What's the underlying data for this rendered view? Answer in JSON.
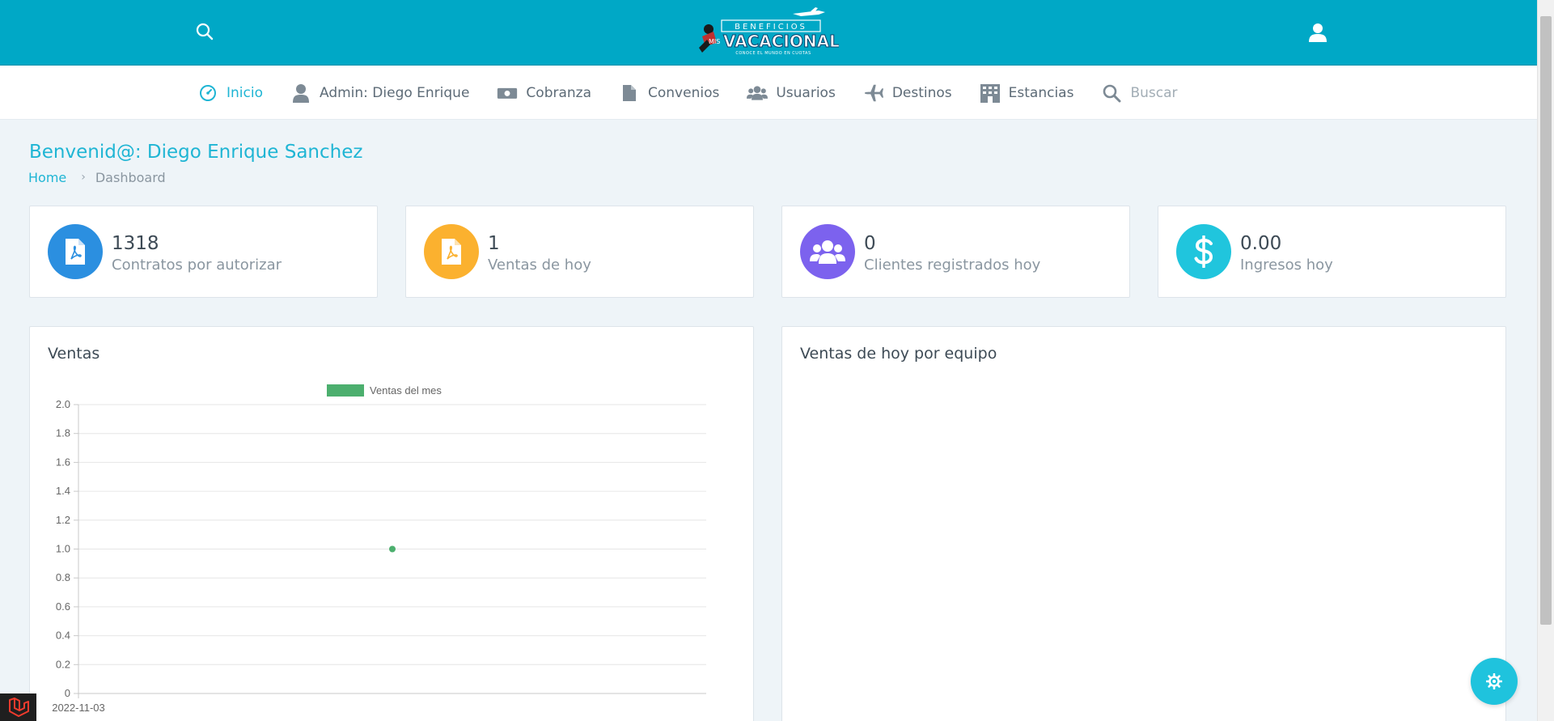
{
  "logo": {
    "line1": "BENEFICIOS",
    "line2_small": "MIS",
    "line2": "VACACIONALES",
    "line3": "CONOCE EL MUNDO EN CUOTAS"
  },
  "nav": {
    "items": [
      {
        "label": "Inicio",
        "icon": "dashboard-icon"
      },
      {
        "label": "Admin: Diego Enrique",
        "icon": "user-icon"
      },
      {
        "label": "Cobranza",
        "icon": "money-icon"
      },
      {
        "label": "Convenios",
        "icon": "file-icon"
      },
      {
        "label": "Usuarios",
        "icon": "users-icon"
      },
      {
        "label": "Destinos",
        "icon": "plane-icon"
      },
      {
        "label": "Estancias",
        "icon": "building-icon"
      },
      {
        "label": "Buscar",
        "icon": "search-icon"
      }
    ]
  },
  "page": {
    "title": "Benvenid@: Diego Enrique Sanchez",
    "breadcrumb_home": "Home",
    "breadcrumb_current": "Dashboard"
  },
  "stats": [
    {
      "value": "1318",
      "label": "Contratos por autorizar",
      "icon": "pdf-file-icon",
      "color": "#2b8fe0"
    },
    {
      "value": "1",
      "label": "Ventas de hoy",
      "icon": "pdf-file-icon",
      "color": "#fbb12f"
    },
    {
      "value": "0",
      "label": "Clientes registrados hoy",
      "icon": "users-icon",
      "color": "#7c62ee"
    },
    {
      "value": "0.00",
      "label": "Ingresos hoy",
      "icon": "dollar-icon",
      "color": "#20c5dd"
    }
  ],
  "panels": {
    "sales_title": "Ventas",
    "team_title": "Ventas de hoy por equipo"
  },
  "colors": {
    "topbar": "#00a8c6",
    "accent": "#1fb5d4",
    "series": "#4caf6e"
  },
  "chart_data": {
    "type": "line",
    "legend": [
      "Ventas del mes"
    ],
    "categories": [
      "2022-11-03"
    ],
    "series": [
      {
        "name": "Ventas del mes",
        "values": [
          1
        ]
      }
    ],
    "ylim": [
      0,
      2
    ],
    "yticks": [
      "2.0",
      "1.8",
      "1.6",
      "1.4",
      "1.2",
      "1.0",
      "0.8",
      "0.6",
      "0.4",
      "0.2",
      "0"
    ],
    "grid": true,
    "legend_position": "top"
  }
}
